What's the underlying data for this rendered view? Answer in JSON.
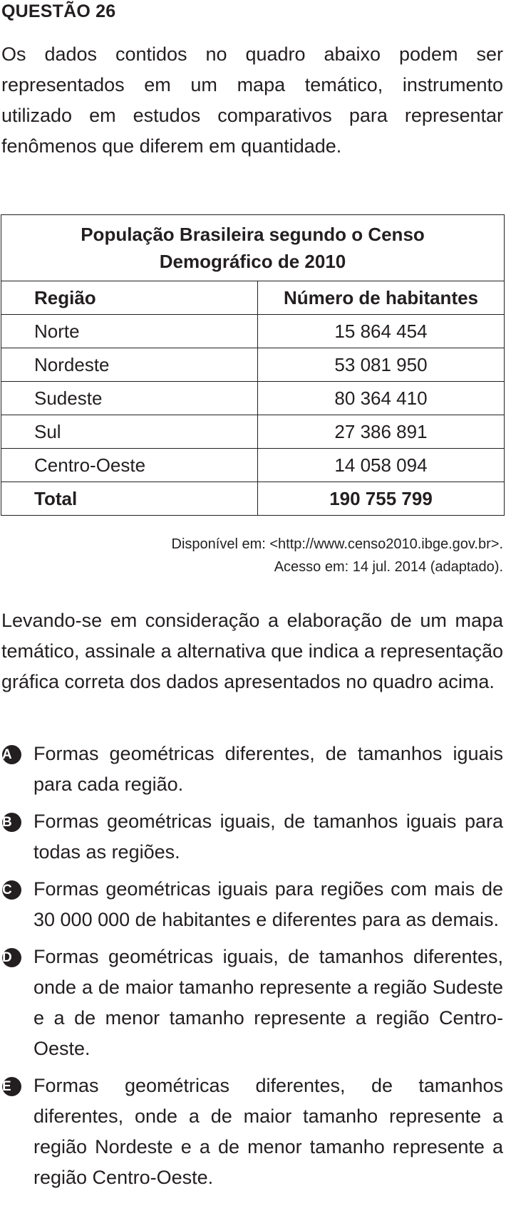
{
  "question": {
    "title": "QUESTÃO 26",
    "intro": "Os dados contidos no quadro abaixo podem ser representados em um mapa temático, instrumento utilizado em estudos comparativos para representar fenômenos que diferem em quantidade."
  },
  "table": {
    "caption_line1": "População Brasileira segundo o Censo",
    "caption_line2": "Demográfico de 2010",
    "headers": [
      "Região",
      "Número de habitantes"
    ],
    "rows": [
      [
        "Norte",
        "15 864 454"
      ],
      [
        "Nordeste",
        "53 081 950"
      ],
      [
        "Sudeste",
        "80 364 410"
      ],
      [
        "Sul",
        "27 386 891"
      ],
      [
        "Centro-Oeste",
        "14 058 094"
      ]
    ],
    "total": [
      "Total",
      "190 755 799"
    ]
  },
  "source": {
    "line1": "Disponível em: <http://www.censo2010.ibge.gov.br>.",
    "line2": "Acesso em: 14 jul. 2014 (adaptado)."
  },
  "prompt": "Levando-se em consideração a elaboração de um mapa temático, assinale a alternativa que indica a representação gráfica correta dos dados apresentados no quadro acima.",
  "options": [
    {
      "letter": "A",
      "text": "Formas geométricas diferentes, de tamanhos iguais para cada região."
    },
    {
      "letter": "B",
      "text": "Formas geométricas iguais, de tamanhos iguais para todas as regiões."
    },
    {
      "letter": "C",
      "text": "Formas geométricas iguais para regiões com mais de 30 000 000 de habitantes e diferentes para as demais."
    },
    {
      "letter": "D",
      "text": "Formas geométricas iguais, de tamanhos diferentes, onde a de maior tamanho represente a região Sudeste e a de menor tamanho represente a região Centro-Oeste."
    },
    {
      "letter": "E",
      "text": "Formas geométricas diferentes, de tamanhos diferentes, onde a de maior tamanho represente a região Nordeste e a de menor tamanho represente a região Centro-Oeste."
    }
  ]
}
